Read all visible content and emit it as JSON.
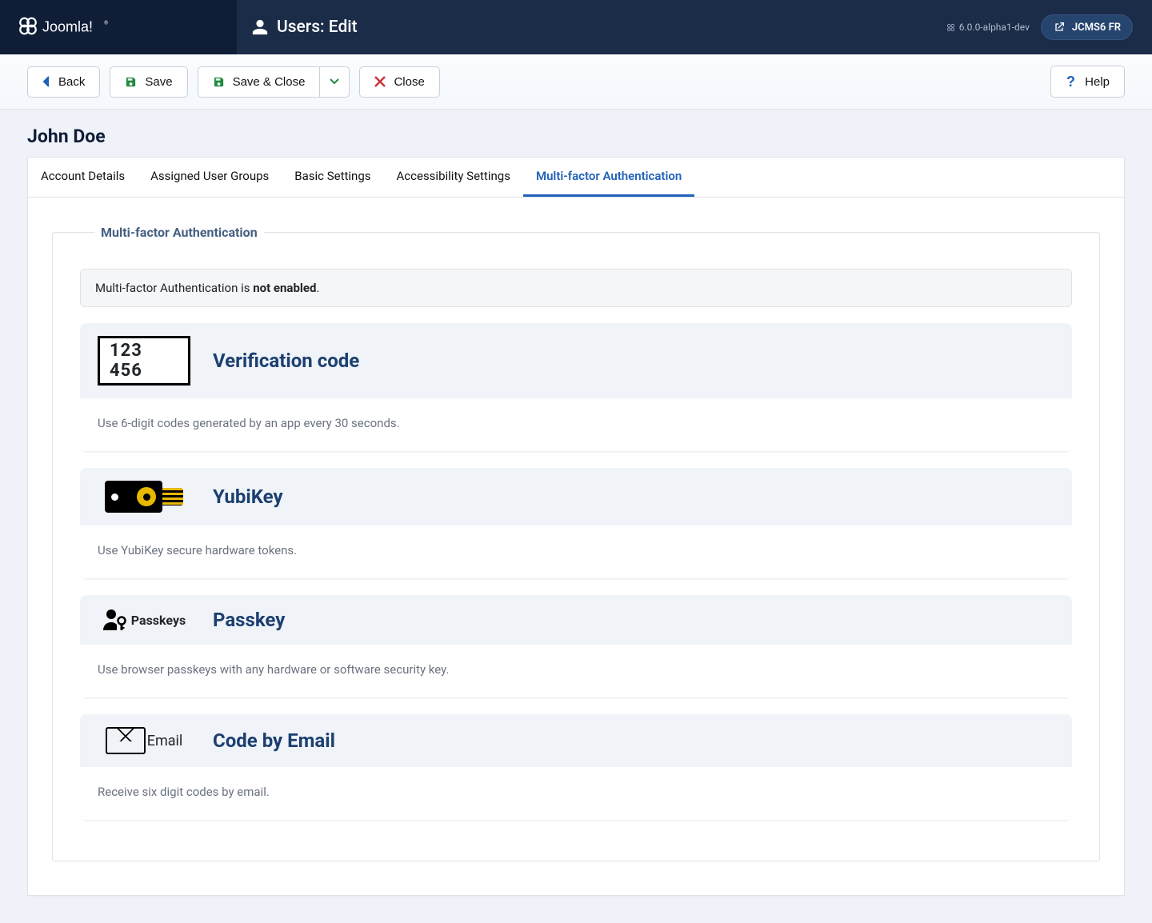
{
  "brand": "Joomla!",
  "page_title": "Users: Edit",
  "version": "6.0.0-alpha1-dev",
  "site_button": "JCMS6 FR",
  "toolbar": {
    "back": "Back",
    "save": "Save",
    "save_close": "Save & Close",
    "close": "Close",
    "help": "Help"
  },
  "user_name": "John Doe",
  "tabs": [
    {
      "label": "Account Details"
    },
    {
      "label": "Assigned User Groups"
    },
    {
      "label": "Basic Settings"
    },
    {
      "label": "Accessibility Settings"
    },
    {
      "label": "Multi-factor Authentication",
      "active": true
    }
  ],
  "mfa": {
    "legend": "Multi-factor Authentication",
    "status_prefix": "Multi-factor Authentication is ",
    "status_bold": "not enabled",
    "status_suffix": ".",
    "methods": [
      {
        "icon": "code-box",
        "icon_text": "123 456",
        "title": "Verification code",
        "desc": "Use 6-digit codes generated by an app every 30 seconds."
      },
      {
        "icon": "yubikey",
        "title": "YubiKey",
        "desc": "Use YubiKey secure hardware tokens."
      },
      {
        "icon": "passkey",
        "icon_text": "Passkeys",
        "title": "Passkey",
        "desc": "Use browser passkeys with any hardware or software security key."
      },
      {
        "icon": "email",
        "icon_text": "Email",
        "title": "Code by Email",
        "desc": "Receive six digit codes by email."
      }
    ]
  }
}
